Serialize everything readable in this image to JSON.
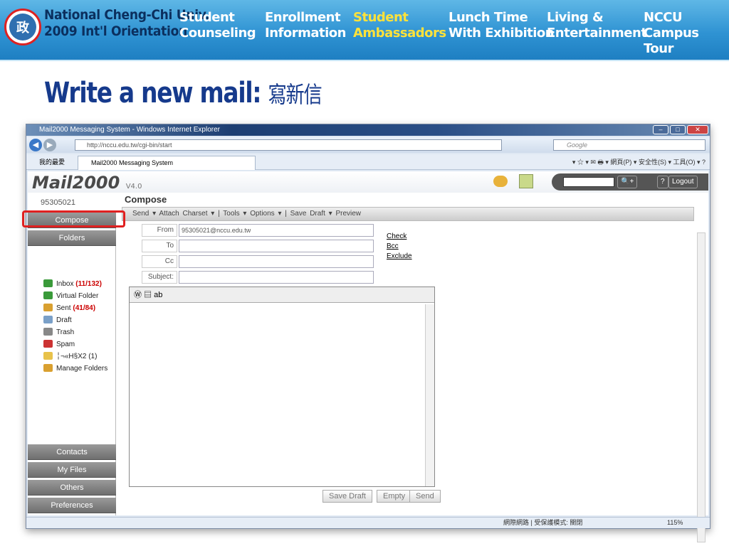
{
  "slide": {
    "school_line1": "National Cheng-Chi Univ.",
    "school_line2": "2009 Int'l Orientation",
    "logo_glyph": "政",
    "nav": [
      {
        "l1": "Student",
        "l2": "Counseling"
      },
      {
        "l1": "Enrollment",
        "l2": "Information"
      },
      {
        "l1": "Student",
        "l2": "Ambassadors"
      },
      {
        "l1": "Lunch Time",
        "l2": "With Exhibition"
      },
      {
        "l1": "Living &",
        "l2": "Entertainment"
      },
      {
        "l1": "NCCU",
        "l2": "Campus Tour"
      }
    ],
    "title": "Write a new mail:",
    "title_zh": "寫新信",
    "accent": "#ffe23a"
  },
  "browser": {
    "title": "Mail2000 Messaging System - Windows Internet Explorer",
    "address": "http://nccu.edu.tw/cgi-bin/start",
    "search_placeholder": "Google",
    "favorites": "我的最愛",
    "tab": "Mail2000 Messaging System",
    "tools": "▾ ☆ ▾ ✉ 🖶 ▾ 網頁(P) ▾  安全性(S) ▾  工具(O) ▾ ?",
    "status": "網際網路 | 受保護模式: 關閉",
    "zoom": "115%"
  },
  "app": {
    "brand": "Mail2000",
    "version": "V4.0",
    "userid": "95305021",
    "logout": "Logout",
    "help": "?",
    "sidebar": {
      "compose": "Compose",
      "folders": "Folders",
      "contacts": "Contacts",
      "myfiles": "My Files",
      "others": "Others",
      "preferences": "Preferences"
    },
    "folders": [
      {
        "label": "Inbox",
        "count": "(11/132)",
        "color": "#3a9a3a"
      },
      {
        "label": "Virtual Folder",
        "count": "",
        "color": "#3a9a3a"
      },
      {
        "label": "Sent",
        "count": "(41/84)",
        "color": "#d9a030"
      },
      {
        "label": "Draft",
        "count": "",
        "color": "#7aa0c8"
      },
      {
        "label": "Trash",
        "count": "",
        "color": "#888"
      },
      {
        "label": "Spam",
        "count": "",
        "color": "#c33"
      },
      {
        "label": "╎¬«H§X2 (1)",
        "count": "",
        "color": "#e8c24a"
      },
      {
        "label": "Manage Folders",
        "count": "",
        "color": "#d9a030"
      }
    ],
    "compose": {
      "title": "Compose",
      "toolbar": "Send ▾  Attach  Charset ▾ | Tools ▾  Options ▾ | Save Draft ▾  Preview",
      "from_label": "From",
      "from_value": "95305021@nccu.edu.tw",
      "to_label": "To",
      "cc_label": "Cc",
      "subject_label": "Subject:",
      "check": "Check",
      "bcc": "Bcc",
      "exclude": "Exclude",
      "save_draft": "Save Draft",
      "empty": "Empty",
      "send": "Send"
    }
  }
}
